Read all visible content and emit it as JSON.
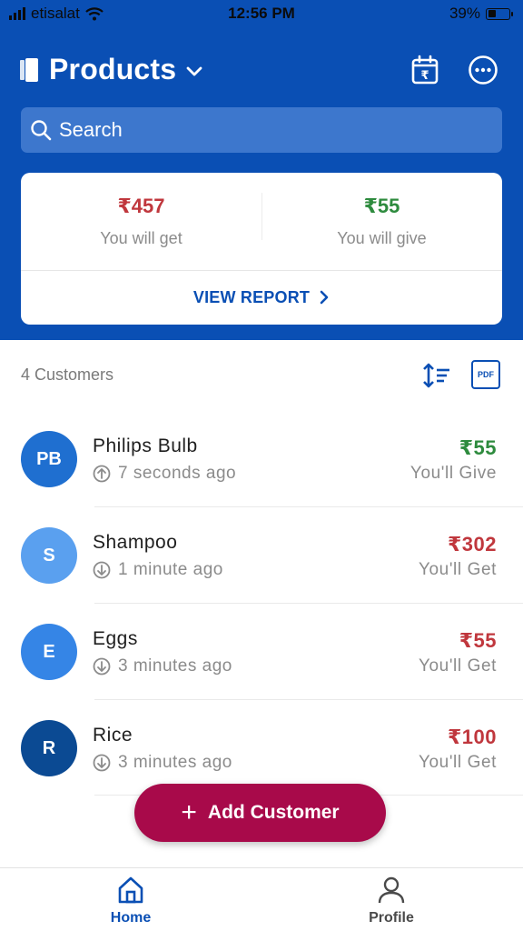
{
  "status_bar": {
    "carrier": "etisalat",
    "time": "12:56 PM",
    "battery": "39%",
    "battery_level": 0.39
  },
  "header": {
    "title": "Products"
  },
  "search": {
    "placeholder": "Search"
  },
  "summary": {
    "get_amount": "₹457",
    "get_label": "You will get",
    "give_amount": "₹55",
    "give_label": "You will give",
    "report_label": "VIEW REPORT"
  },
  "list": {
    "count_label": "4 Customers",
    "pdf_label": "PDF"
  },
  "customers": [
    {
      "initials": "PB",
      "name": "Philips Bulb",
      "time": "7 seconds ago",
      "amount": "₹55",
      "status": "You'll Give"
    },
    {
      "initials": "S",
      "name": "Shampoo",
      "time": "1 minute ago",
      "amount": "₹302",
      "status": "You'll Get"
    },
    {
      "initials": "E",
      "name": "Eggs",
      "time": "3 minutes ago",
      "amount": "₹55",
      "status": "You'll Get"
    },
    {
      "initials": "R",
      "name": "Rice",
      "time": "3 minutes ago",
      "amount": "₹100",
      "status": "You'll Get"
    }
  ],
  "fab": {
    "label": "Add Customer"
  },
  "nav": {
    "home": "Home",
    "profile": "Profile"
  },
  "colors": {
    "primary": "#0a4fb4",
    "get_red": "#c0373d",
    "give_green": "#2e8b3e",
    "fab": "#a80a4a",
    "avatar_pb": "#1f6fd0",
    "avatar_s": "#5aa0ef",
    "avatar_e": "#3585e6",
    "avatar_r": "#0b4a93"
  },
  "icons": [
    "book-icon",
    "chevron-down-icon",
    "calendar-rupee-icon",
    "more-icon",
    "search-icon",
    "chevron-right-icon",
    "sort-icon",
    "pdf-icon",
    "arrow-up-circle-icon",
    "arrow-down-circle-icon",
    "plus-icon",
    "home-icon",
    "profile-icon"
  ]
}
